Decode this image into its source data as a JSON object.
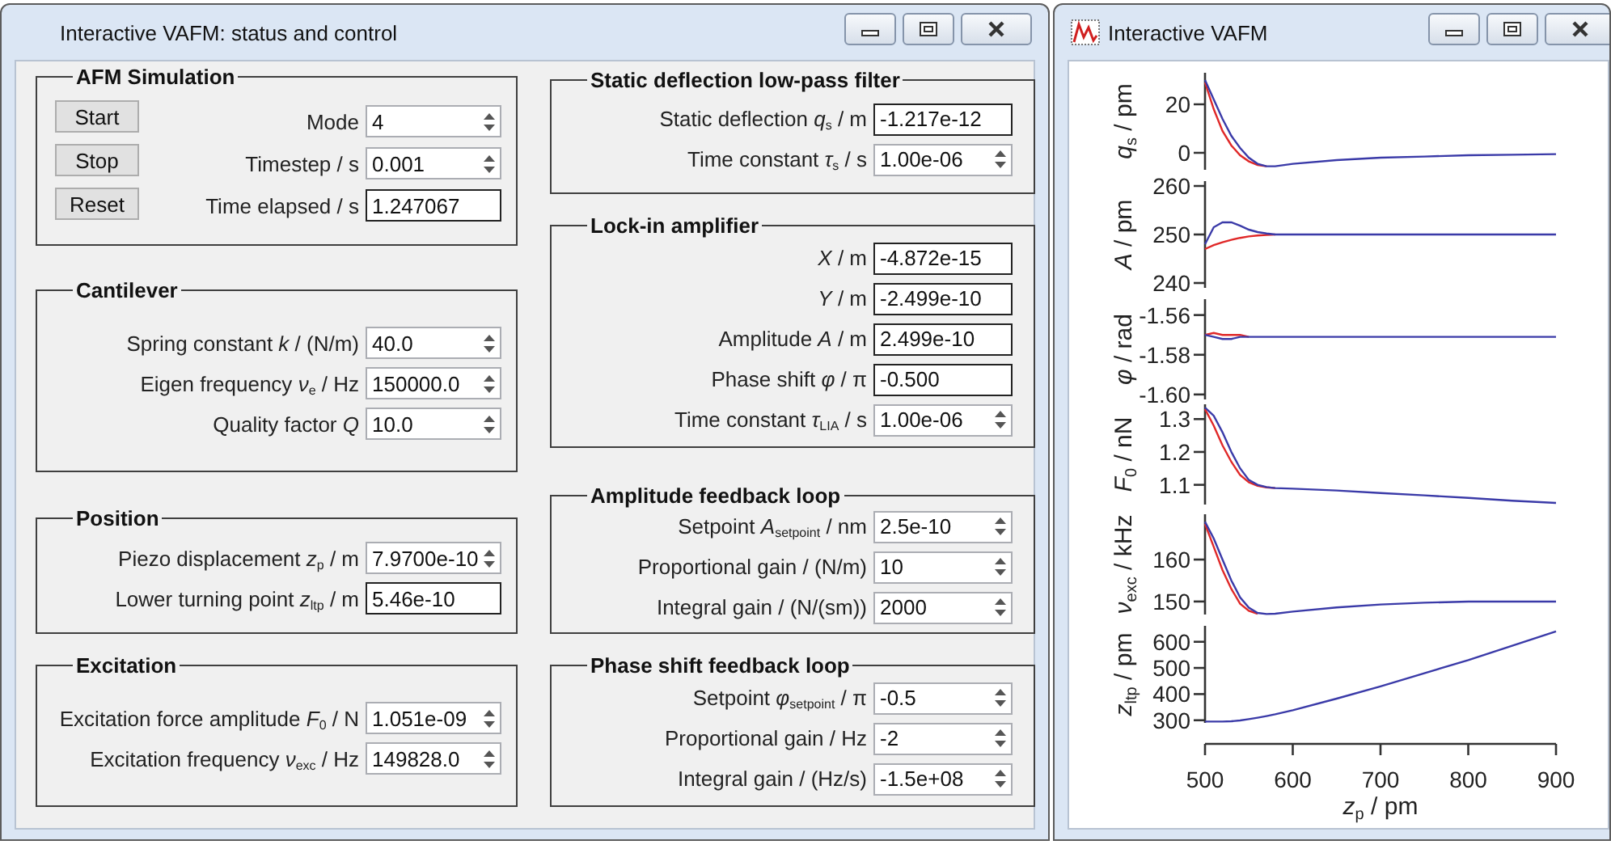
{
  "control_window": {
    "title": "Interactive VAFM: status and control",
    "left_column": [
      {
        "title": "AFM Simulation",
        "buttons": [
          "Start",
          "Stop",
          "Reset"
        ],
        "rows": [
          {
            "label": "Mode",
            "value": "4",
            "kind": "spin"
          },
          {
            "label": "Timestep / s",
            "value": "0.001",
            "kind": "spin"
          },
          {
            "label": "Time elapsed / s",
            "value": "1.247067",
            "kind": "display"
          }
        ]
      },
      {
        "title": "Cantilever",
        "rows": [
          {
            "label": "Spring constant *k* / (N/m)",
            "value": "40.0",
            "kind": "spin"
          },
          {
            "label": "Eigen frequency *ν*$_{e}$ / Hz",
            "value": "150000.0",
            "kind": "spin"
          },
          {
            "label": "Quality factor *Q*",
            "value": "10.0",
            "kind": "spin"
          }
        ]
      },
      {
        "title": "Position",
        "rows": [
          {
            "label": "Piezo displacement *z*$_{p}$ / m",
            "value": "7.9700e-10",
            "kind": "spin"
          },
          {
            "label": "Lower turning point *z*$_{ltp}$ / m",
            "value": "5.46e-10",
            "kind": "display"
          }
        ]
      },
      {
        "title": "Excitation",
        "rows": [
          {
            "label": "Excitation force amplitude *F*$_{0}$ / N",
            "value": "1.051e-09",
            "kind": "spin"
          },
          {
            "label": "Excitation frequency *ν*$_{exc}$ / Hz",
            "value": "149828.0",
            "kind": "spin"
          }
        ]
      }
    ],
    "right_column": [
      {
        "title": "Static deflection low-pass filter",
        "rows": [
          {
            "label": "Static deflection *q*$_{s}$ / m",
            "value": "-1.217e-12",
            "kind": "display"
          },
          {
            "label": "Time constant *τ*$_{s}$ / s",
            "value": "1.00e-06",
            "kind": "spin"
          }
        ]
      },
      {
        "title": "Lock-in amplifier",
        "rows": [
          {
            "label": "*X* / m",
            "value": "-4.872e-15",
            "kind": "display"
          },
          {
            "label": "*Y* / m",
            "value": "-2.499e-10",
            "kind": "display"
          },
          {
            "label": "Amplitude *A* / m",
            "value": "2.499e-10",
            "kind": "display"
          },
          {
            "label": "Phase shift *φ* / π",
            "value": "-0.500",
            "kind": "display"
          },
          {
            "label": "Time constant *τ*$_{LIA}$ / s",
            "value": "1.00e-06",
            "kind": "spin"
          }
        ]
      },
      {
        "title": "Amplitude feedback loop",
        "rows": [
          {
            "label": "Setpoint *A*$_{setpoint}$ / nm",
            "value": "2.5e-10",
            "kind": "spin"
          },
          {
            "label": "Proportional gain / (N/m)",
            "value": "10",
            "kind": "spin"
          },
          {
            "label": "Integral gain / (N/(sm))",
            "value": "2000",
            "kind": "spin"
          }
        ]
      },
      {
        "title": "Phase shift feedback loop",
        "rows": [
          {
            "label": "Setpoint *φ*$_{setpoint}$ / π",
            "value": "-0.5",
            "kind": "spin"
          },
          {
            "label": "Proportional gain / Hz",
            "value": "-2",
            "kind": "spin"
          },
          {
            "label": "Integral gain / (Hz/s)",
            "value": "-1.5e+08",
            "kind": "spin"
          }
        ]
      }
    ]
  },
  "plot_window": {
    "title": "Interactive VAFM",
    "panels": [
      {
        "chart_data": {
          "type": "line",
          "ylabel": "*q*$_{s}$ / pm",
          "x": [
            500,
            510,
            520,
            530,
            540,
            550,
            560,
            570,
            580,
            600,
            650,
            700,
            750,
            800,
            850,
            900
          ],
          "xlim": [
            500,
            900
          ],
          "ylim": [
            -7,
            33
          ],
          "yticks": [
            0,
            20
          ],
          "series": [
            {
              "color": "#e02828",
              "values": [
                29,
                18,
                9,
                3,
                -1,
                -3.5,
                -5,
                -5.5,
                null,
                null,
                null,
                null,
                null,
                null,
                null,
                null
              ]
            },
            {
              "color": "#3a3aa8",
              "values": [
                30,
                22,
                14,
                7,
                2,
                -2,
                -4.5,
                -5.5,
                -5.5,
                -4.5,
                -3,
                -2,
                -1.5,
                -1,
                -0.8,
                -0.5
              ]
            }
          ]
        }
      },
      {
        "chart_data": {
          "type": "line",
          "ylabel": "*A* / pm",
          "x": [
            500,
            510,
            520,
            530,
            540,
            550,
            560,
            570,
            580,
            600,
            650,
            700,
            750,
            800,
            850,
            900
          ],
          "xlim": [
            500,
            900
          ],
          "ylim": [
            239,
            261
          ],
          "yticks": [
            240,
            250,
            260
          ],
          "series": [
            {
              "color": "#e02828",
              "values": [
                247,
                247.8,
                248.4,
                248.9,
                249.3,
                249.6,
                249.8,
                249.9,
                250,
                null,
                null,
                null,
                null,
                null,
                null,
                null
              ]
            },
            {
              "color": "#3a3aa8",
              "values": [
                248,
                251.5,
                252.5,
                252.5,
                251.8,
                251,
                250.5,
                250.2,
                250,
                250,
                250,
                250,
                250,
                250,
                250,
                250
              ]
            }
          ]
        }
      },
      {
        "chart_data": {
          "type": "line",
          "ylabel": "*φ* / rad",
          "x": [
            500,
            510,
            520,
            530,
            540,
            550,
            560,
            570,
            580,
            600,
            650,
            700,
            750,
            800,
            850,
            900
          ],
          "xlim": [
            500,
            900
          ],
          "ylim": [
            -1.6025,
            -1.552
          ],
          "yticks": [
            {
              "value": -1.56,
              "label": "-1.56"
            },
            {
              "value": -1.58,
              "label": "-1.58"
            },
            {
              "value": -1.6,
              "label": "-1.60"
            }
          ],
          "series": [
            {
              "color": "#e02828",
              "values": [
                -1.57,
                -1.569,
                -1.57,
                -1.57,
                -1.57,
                -1.571,
                null,
                null,
                null,
                null,
                null,
                null,
                null,
                null,
                null,
                null
              ]
            },
            {
              "color": "#3a3aa8",
              "values": [
                -1.57,
                -1.571,
                -1.572,
                -1.572,
                -1.571,
                -1.571,
                -1.571,
                -1.571,
                -1.571,
                -1.571,
                -1.571,
                -1.571,
                -1.571,
                -1.571,
                -1.571,
                -1.571
              ]
            }
          ]
        }
      },
      {
        "chart_data": {
          "type": "line",
          "ylabel": "*F*$_{0}$ / nN",
          "x": [
            500,
            510,
            520,
            530,
            540,
            550,
            560,
            570,
            580,
            600,
            650,
            700,
            750,
            800,
            850,
            900
          ],
          "xlim": [
            500,
            900
          ],
          "ylim": [
            1.04,
            1.345
          ],
          "yticks": [
            1.1,
            1.2,
            1.3
          ],
          "series": [
            {
              "color": "#e02828",
              "values": [
                1.33,
                1.28,
                1.22,
                1.17,
                1.13,
                1.108,
                1.097,
                1.092,
                1.09,
                null,
                null,
                null,
                null,
                null,
                null,
                null
              ]
            },
            {
              "color": "#3a3aa8",
              "values": [
                1.335,
                1.31,
                1.26,
                1.2,
                1.15,
                1.115,
                1.1,
                1.093,
                1.09,
                1.088,
                1.083,
                1.075,
                1.068,
                1.06,
                1.052,
                1.045
              ]
            }
          ]
        }
      },
      {
        "chart_data": {
          "type": "line",
          "ylabel": "*ν*$_{exc}$ / kHz",
          "x": [
            500,
            510,
            520,
            530,
            540,
            550,
            560,
            570,
            580,
            600,
            650,
            700,
            750,
            800,
            850,
            900
          ],
          "xlim": [
            500,
            900
          ],
          "ylim": [
            146.9,
            170.8
          ],
          "yticks": [
            150,
            160
          ],
          "series": [
            {
              "color": "#e02828",
              "values": [
                168.5,
                163,
                157.5,
                153,
                149.5,
                147.8,
                147.1,
                null,
                null,
                null,
                null,
                null,
                null,
                null,
                null,
                null
              ]
            },
            {
              "color": "#3a3aa8",
              "values": [
                169,
                165,
                160,
                155,
                151,
                148.5,
                147.3,
                147,
                147.1,
                147.6,
                148.6,
                149.3,
                149.7,
                150,
                150,
                150
              ]
            }
          ]
        }
      },
      {
        "chart_data": {
          "type": "line",
          "ylabel": "*z*$_{ltp}$ / pm",
          "xlabel": "*z*$_{p}$ / pm",
          "x": [
            500,
            510,
            520,
            530,
            540,
            550,
            560,
            570,
            580,
            600,
            650,
            700,
            750,
            800,
            850,
            900
          ],
          "xlim": [
            500,
            900
          ],
          "ylim": [
            290,
            661
          ],
          "xticks": [
            500,
            600,
            700,
            800,
            900
          ],
          "yticks": [
            300,
            400,
            500,
            600
          ],
          "series": [
            {
              "color": "#3a3aa8",
              "values": [
                295,
                295,
                295,
                296,
                299,
                304,
                310,
                316,
                323,
                338,
                383,
                430,
                480,
                530,
                585,
                640
              ]
            }
          ]
        }
      }
    ]
  }
}
